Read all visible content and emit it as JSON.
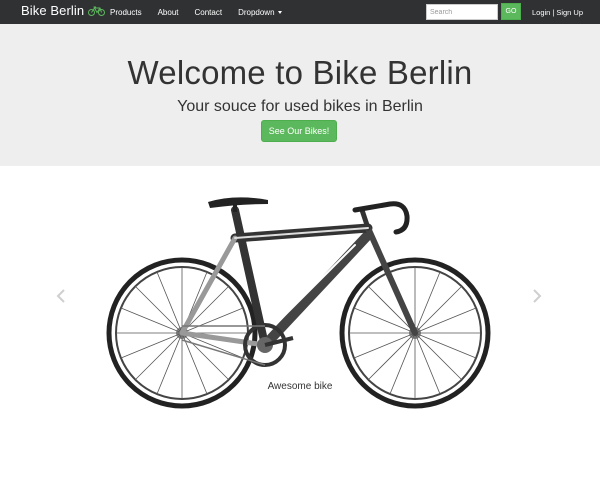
{
  "navbar": {
    "brand": "Bike Berlin",
    "brand_icon": "bicycle-icon",
    "links": [
      "Products",
      "About",
      "Contact"
    ],
    "dropdown_label": "Dropdown",
    "search": {
      "placeholder": "Search",
      "value": ""
    },
    "go_label": "GO",
    "login_label": "Login",
    "separator": "|",
    "signup_label": "Sign Up"
  },
  "hero": {
    "title": "Welcome to Bike Berlin",
    "subtitle": "Your souce for used bikes in Berlin",
    "button_label": "See Our Bikes!"
  },
  "carousel": {
    "caption": "Awesome bike",
    "prev_icon": "chevron-left-icon",
    "next_icon": "chevron-right-icon"
  },
  "colors": {
    "navbar_bg": "#2f3133",
    "jumbotron_bg": "#eeeeee",
    "accent_green": "#5cb85c"
  }
}
